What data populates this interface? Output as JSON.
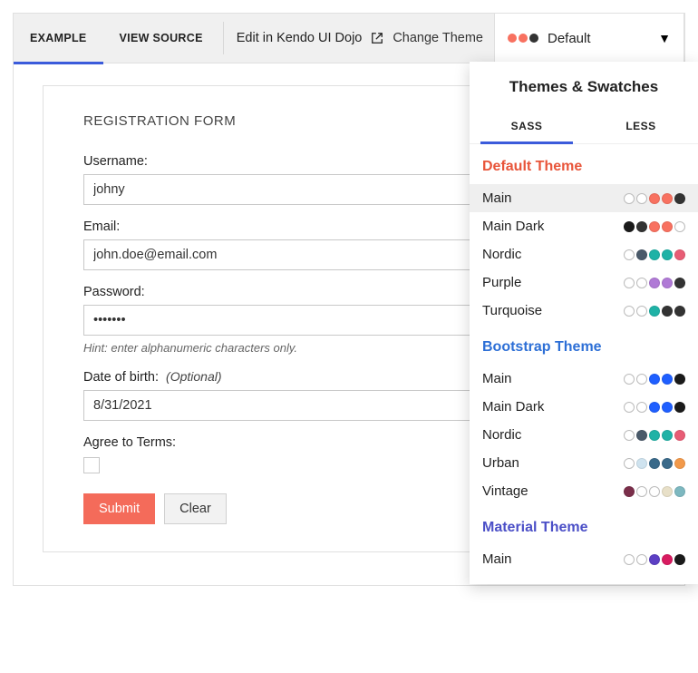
{
  "toolbar": {
    "tabs": [
      "EXAMPLE",
      "VIEW SOURCE"
    ],
    "active_tab": 0,
    "edit_label": "Edit in Kendo UI Dojo",
    "change_theme_label": "Change Theme",
    "selected_theme": "Default",
    "selected_dots": [
      "#f87160",
      "#f87160",
      "#333333"
    ]
  },
  "form": {
    "title": "REGISTRATION FORM",
    "username_label": "Username:",
    "username_value": "johny",
    "email_label": "Email:",
    "email_value": "john.doe@email.com",
    "password_label": "Password:",
    "password_value": "•••••••",
    "password_hint": "Hint: enter alphanumeric characters only.",
    "dob_label": "Date of birth:",
    "dob_optional": "(Optional)",
    "dob_value": "8/31/2021",
    "agree_label": "Agree to Terms:",
    "submit_label": "Submit",
    "clear_label": "Clear"
  },
  "popover": {
    "title": "Themes & Swatches",
    "tabs": [
      "SASS",
      "LESS"
    ],
    "active_tab": 0,
    "sections": [
      {
        "title": "Default Theme",
        "color_class": "red",
        "swatches": [
          {
            "name": "Main",
            "active": true,
            "dots": [
              "#ffffff",
              "#ffffff",
              "#f87160",
              "#f87160",
              "#333333"
            ]
          },
          {
            "name": "Main Dark",
            "active": false,
            "dots": [
              "#1a1a1a",
              "#333333",
              "#f87160",
              "#f87160",
              "#ffffff"
            ]
          },
          {
            "name": "Nordic",
            "active": false,
            "dots": [
              "#ffffff",
              "#4a5a6a",
              "#1fb2a6",
              "#1fb2a6",
              "#e85d75"
            ]
          },
          {
            "name": "Purple",
            "active": false,
            "dots": [
              "#ffffff",
              "#ffffff",
              "#b07ad6",
              "#b07ad6",
              "#333333"
            ]
          },
          {
            "name": "Turquoise",
            "active": false,
            "dots": [
              "#ffffff",
              "#ffffff",
              "#1fb2a6",
              "#333333",
              "#333333"
            ]
          }
        ]
      },
      {
        "title": "Bootstrap Theme",
        "color_class": "blue",
        "swatches": [
          {
            "name": "Main",
            "active": false,
            "dots": [
              "#ffffff",
              "#ffffff",
              "#1f5fff",
              "#1f5fff",
              "#1a1a1a"
            ]
          },
          {
            "name": "Main Dark",
            "active": false,
            "dots": [
              "#ffffff",
              "#ffffff",
              "#1f5fff",
              "#1f5fff",
              "#1a1a1a"
            ]
          },
          {
            "name": "Nordic",
            "active": false,
            "dots": [
              "#ffffff",
              "#4a5a6a",
              "#1fb2a6",
              "#1fb2a6",
              "#e85d75"
            ]
          },
          {
            "name": "Urban",
            "active": false,
            "dots": [
              "#ffffff",
              "#cfe3ef",
              "#3a6a8a",
              "#3a6a8a",
              "#f2994a"
            ]
          },
          {
            "name": "Vintage",
            "active": false,
            "dots": [
              "#7a2e4a",
              "#ffffff",
              "#ffffff",
              "#e8e0c8",
              "#7db8c0"
            ]
          }
        ]
      },
      {
        "title": "Material Theme",
        "color_class": "indigo",
        "swatches": [
          {
            "name": "Main",
            "active": false,
            "dots": [
              "#ffffff",
              "#ffffff",
              "#5c3fc4",
              "#d81b60",
              "#1a1a1a"
            ]
          }
        ]
      }
    ]
  }
}
